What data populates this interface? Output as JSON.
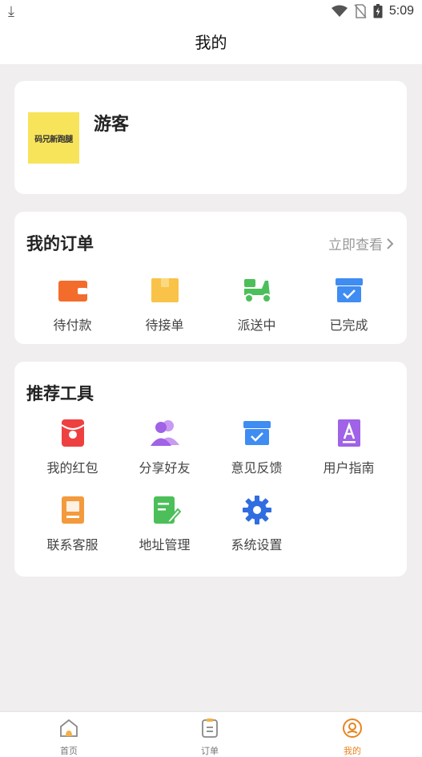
{
  "status_bar": {
    "time": "5:09"
  },
  "header": {
    "title": "我的"
  },
  "profile": {
    "avatar_text": "码兄新跑腿",
    "username": "游客"
  },
  "orders": {
    "title": "我的订单",
    "view_all": "立即查看",
    "items": [
      {
        "label": "待付款",
        "icon": "wallet-icon"
      },
      {
        "label": "待接单",
        "icon": "package-icon"
      },
      {
        "label": "派送中",
        "icon": "scooter-icon"
      },
      {
        "label": "已完成",
        "icon": "box-check-icon"
      }
    ]
  },
  "tools": {
    "title": "推荐工具",
    "items": [
      {
        "label": "我的红包",
        "icon": "red-envelope-icon"
      },
      {
        "label": "分享好友",
        "icon": "share-friends-icon"
      },
      {
        "label": "意见反馈",
        "icon": "feedback-icon"
      },
      {
        "label": "用户指南",
        "icon": "user-guide-icon"
      },
      {
        "label": "联系客服",
        "icon": "customer-service-icon"
      },
      {
        "label": "地址管理",
        "icon": "address-icon"
      },
      {
        "label": "系统设置",
        "icon": "settings-icon"
      }
    ]
  },
  "tab_bar": {
    "tabs": [
      {
        "label": "首页",
        "icon": "home-icon"
      },
      {
        "label": "订单",
        "icon": "order-icon"
      },
      {
        "label": "我的",
        "icon": "profile-icon",
        "active": true
      }
    ]
  },
  "colors": {
    "accent": "#e8841f",
    "orange": "#f36c2c",
    "yellow": "#f9c34a",
    "green": "#4cbf5a",
    "blue": "#3f8cf2",
    "red": "#ee4040",
    "purple": "#a062e6"
  }
}
